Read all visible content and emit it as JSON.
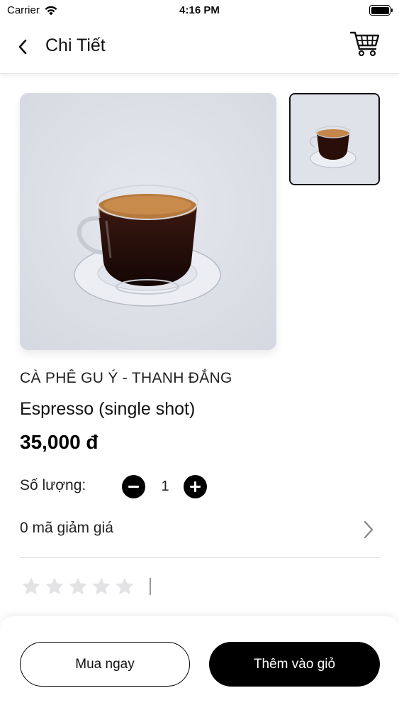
{
  "status_bar": {
    "carrier": "Carrier",
    "time": "4:16 PM"
  },
  "nav": {
    "title": "Chi Tiết",
    "back_icon": "chevron-left-icon",
    "cart_icon": "shopping-cart-icon"
  },
  "product": {
    "brand": "CÀ PHÊ GU Ý - THANH ĐẮNG",
    "name": "Espresso (single shot)",
    "price": "35,000 đ",
    "images": [
      "espresso-cup-photo",
      "espresso-cup-thumbnail"
    ]
  },
  "quantity": {
    "label": "Số lượng:",
    "value": "1"
  },
  "coupon": {
    "text": "0 mã giảm giá"
  },
  "rating": {
    "stars_filled": 0,
    "stars_total": 5
  },
  "actions": {
    "buy_now": "Mua ngay",
    "add_to_cart": "Thêm vào giỏ"
  },
  "colors": {
    "primary": "#000000",
    "star_empty": "#e3e3e6",
    "image_bg": "#dde0e8"
  }
}
